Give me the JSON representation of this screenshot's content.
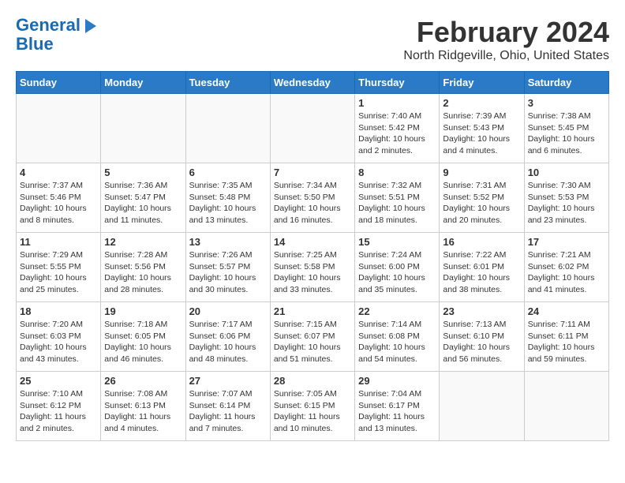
{
  "header": {
    "logo_line1": "General",
    "logo_line2": "Blue",
    "title": "February 2024",
    "subtitle": "North Ridgeville, Ohio, United States"
  },
  "weekdays": [
    "Sunday",
    "Monday",
    "Tuesday",
    "Wednesday",
    "Thursday",
    "Friday",
    "Saturday"
  ],
  "weeks": [
    [
      {
        "day": "",
        "info": ""
      },
      {
        "day": "",
        "info": ""
      },
      {
        "day": "",
        "info": ""
      },
      {
        "day": "",
        "info": ""
      },
      {
        "day": "1",
        "info": "Sunrise: 7:40 AM\nSunset: 5:42 PM\nDaylight: 10 hours\nand 2 minutes."
      },
      {
        "day": "2",
        "info": "Sunrise: 7:39 AM\nSunset: 5:43 PM\nDaylight: 10 hours\nand 4 minutes."
      },
      {
        "day": "3",
        "info": "Sunrise: 7:38 AM\nSunset: 5:45 PM\nDaylight: 10 hours\nand 6 minutes."
      }
    ],
    [
      {
        "day": "4",
        "info": "Sunrise: 7:37 AM\nSunset: 5:46 PM\nDaylight: 10 hours\nand 8 minutes."
      },
      {
        "day": "5",
        "info": "Sunrise: 7:36 AM\nSunset: 5:47 PM\nDaylight: 10 hours\nand 11 minutes."
      },
      {
        "day": "6",
        "info": "Sunrise: 7:35 AM\nSunset: 5:48 PM\nDaylight: 10 hours\nand 13 minutes."
      },
      {
        "day": "7",
        "info": "Sunrise: 7:34 AM\nSunset: 5:50 PM\nDaylight: 10 hours\nand 16 minutes."
      },
      {
        "day": "8",
        "info": "Sunrise: 7:32 AM\nSunset: 5:51 PM\nDaylight: 10 hours\nand 18 minutes."
      },
      {
        "day": "9",
        "info": "Sunrise: 7:31 AM\nSunset: 5:52 PM\nDaylight: 10 hours\nand 20 minutes."
      },
      {
        "day": "10",
        "info": "Sunrise: 7:30 AM\nSunset: 5:53 PM\nDaylight: 10 hours\nand 23 minutes."
      }
    ],
    [
      {
        "day": "11",
        "info": "Sunrise: 7:29 AM\nSunset: 5:55 PM\nDaylight: 10 hours\nand 25 minutes."
      },
      {
        "day": "12",
        "info": "Sunrise: 7:28 AM\nSunset: 5:56 PM\nDaylight: 10 hours\nand 28 minutes."
      },
      {
        "day": "13",
        "info": "Sunrise: 7:26 AM\nSunset: 5:57 PM\nDaylight: 10 hours\nand 30 minutes."
      },
      {
        "day": "14",
        "info": "Sunrise: 7:25 AM\nSunset: 5:58 PM\nDaylight: 10 hours\nand 33 minutes."
      },
      {
        "day": "15",
        "info": "Sunrise: 7:24 AM\nSunset: 6:00 PM\nDaylight: 10 hours\nand 35 minutes."
      },
      {
        "day": "16",
        "info": "Sunrise: 7:22 AM\nSunset: 6:01 PM\nDaylight: 10 hours\nand 38 minutes."
      },
      {
        "day": "17",
        "info": "Sunrise: 7:21 AM\nSunset: 6:02 PM\nDaylight: 10 hours\nand 41 minutes."
      }
    ],
    [
      {
        "day": "18",
        "info": "Sunrise: 7:20 AM\nSunset: 6:03 PM\nDaylight: 10 hours\nand 43 minutes."
      },
      {
        "day": "19",
        "info": "Sunrise: 7:18 AM\nSunset: 6:05 PM\nDaylight: 10 hours\nand 46 minutes."
      },
      {
        "day": "20",
        "info": "Sunrise: 7:17 AM\nSunset: 6:06 PM\nDaylight: 10 hours\nand 48 minutes."
      },
      {
        "day": "21",
        "info": "Sunrise: 7:15 AM\nSunset: 6:07 PM\nDaylight: 10 hours\nand 51 minutes."
      },
      {
        "day": "22",
        "info": "Sunrise: 7:14 AM\nSunset: 6:08 PM\nDaylight: 10 hours\nand 54 minutes."
      },
      {
        "day": "23",
        "info": "Sunrise: 7:13 AM\nSunset: 6:10 PM\nDaylight: 10 hours\nand 56 minutes."
      },
      {
        "day": "24",
        "info": "Sunrise: 7:11 AM\nSunset: 6:11 PM\nDaylight: 10 hours\nand 59 minutes."
      }
    ],
    [
      {
        "day": "25",
        "info": "Sunrise: 7:10 AM\nSunset: 6:12 PM\nDaylight: 11 hours\nand 2 minutes."
      },
      {
        "day": "26",
        "info": "Sunrise: 7:08 AM\nSunset: 6:13 PM\nDaylight: 11 hours\nand 4 minutes."
      },
      {
        "day": "27",
        "info": "Sunrise: 7:07 AM\nSunset: 6:14 PM\nDaylight: 11 hours\nand 7 minutes."
      },
      {
        "day": "28",
        "info": "Sunrise: 7:05 AM\nSunset: 6:15 PM\nDaylight: 11 hours\nand 10 minutes."
      },
      {
        "day": "29",
        "info": "Sunrise: 7:04 AM\nSunset: 6:17 PM\nDaylight: 11 hours\nand 13 minutes."
      },
      {
        "day": "",
        "info": ""
      },
      {
        "day": "",
        "info": ""
      }
    ]
  ]
}
